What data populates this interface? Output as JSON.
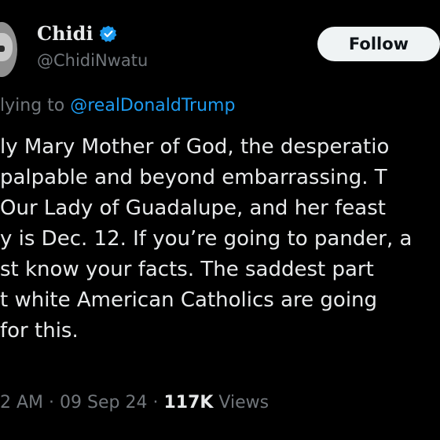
{
  "author": {
    "name": "Chidi",
    "handle": "@ChidiNwatu",
    "verified_icon": "verified-badge-icon",
    "verified_color": "#1d9bf0"
  },
  "follow_button": {
    "label": "Follow"
  },
  "reply": {
    "prefix": "lying to",
    "mention": "@realDonaldTrump"
  },
  "tweet_lines": [
    "ly Mary Mother of God, the desperatio",
    "palpable and beyond embarrassing. T",
    "Our Lady of Guadalupe, and her feast",
    "y is Dec. 12. If you’re going to pander, a",
    "st know your facts. The saddest part",
    "t white American Catholics are going",
    " for this."
  ],
  "meta": {
    "time": "2 AM",
    "sep1": " · ",
    "date": "09 Sep 24",
    "sep2": " · ",
    "views_count": "117K",
    "views_label": " Views"
  },
  "colors": {
    "background": "#000000",
    "text": "#e7e9ea",
    "secondary": "#71767b",
    "accent": "#1d9bf0",
    "button_bg": "#eff3f4"
  }
}
